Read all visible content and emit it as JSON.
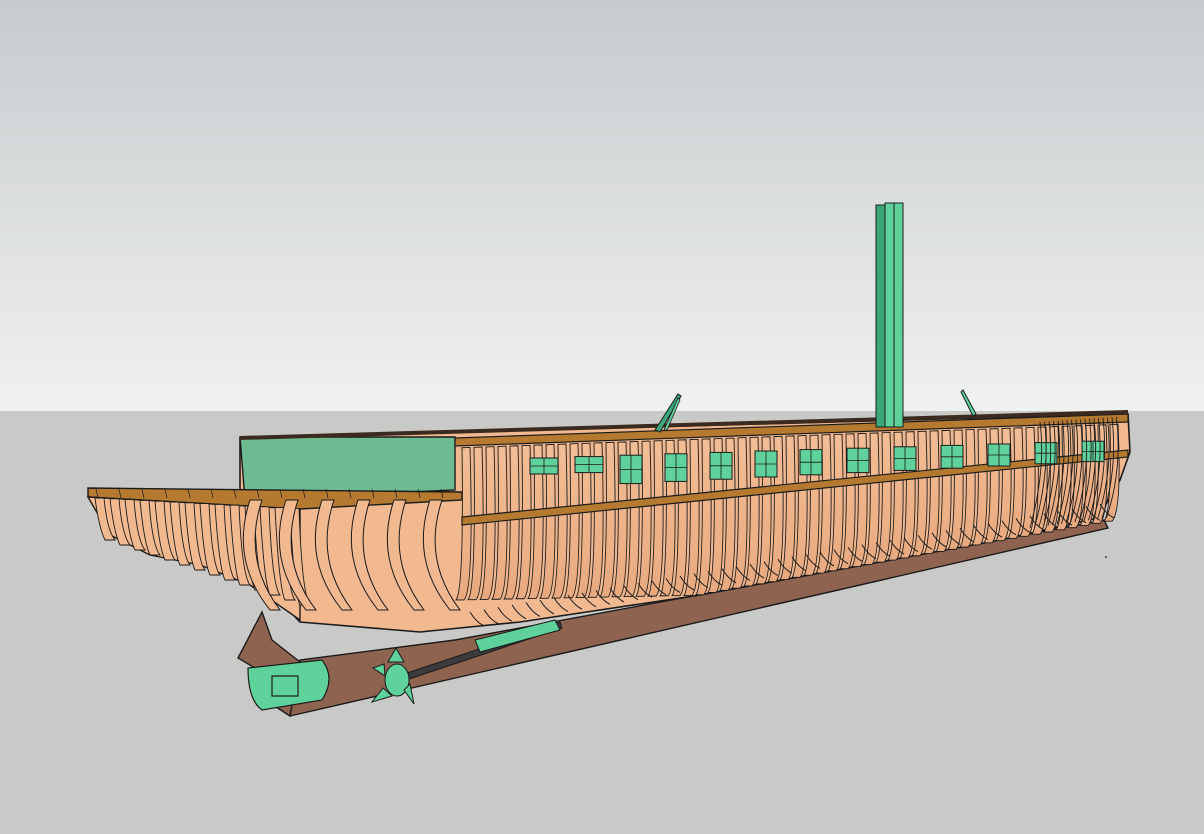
{
  "scene": {
    "subject": "",
    "colors": {
      "sky_top": "#c7cbcd",
      "sky_bottom": "#f0f1f1",
      "ground": "#c9cac7",
      "frame_wood": "#f2b88f",
      "frame_shade": "#e2a179",
      "keel_brown": "#8e6450",
      "deck_rail": "#b57a2f",
      "green_part": "#5fd29c",
      "green_dark": "#3aa77a",
      "deck_wall": "#6dbb90",
      "outline": "#1b1b1b"
    },
    "portholes": 13,
    "bow_frames": 46
  }
}
